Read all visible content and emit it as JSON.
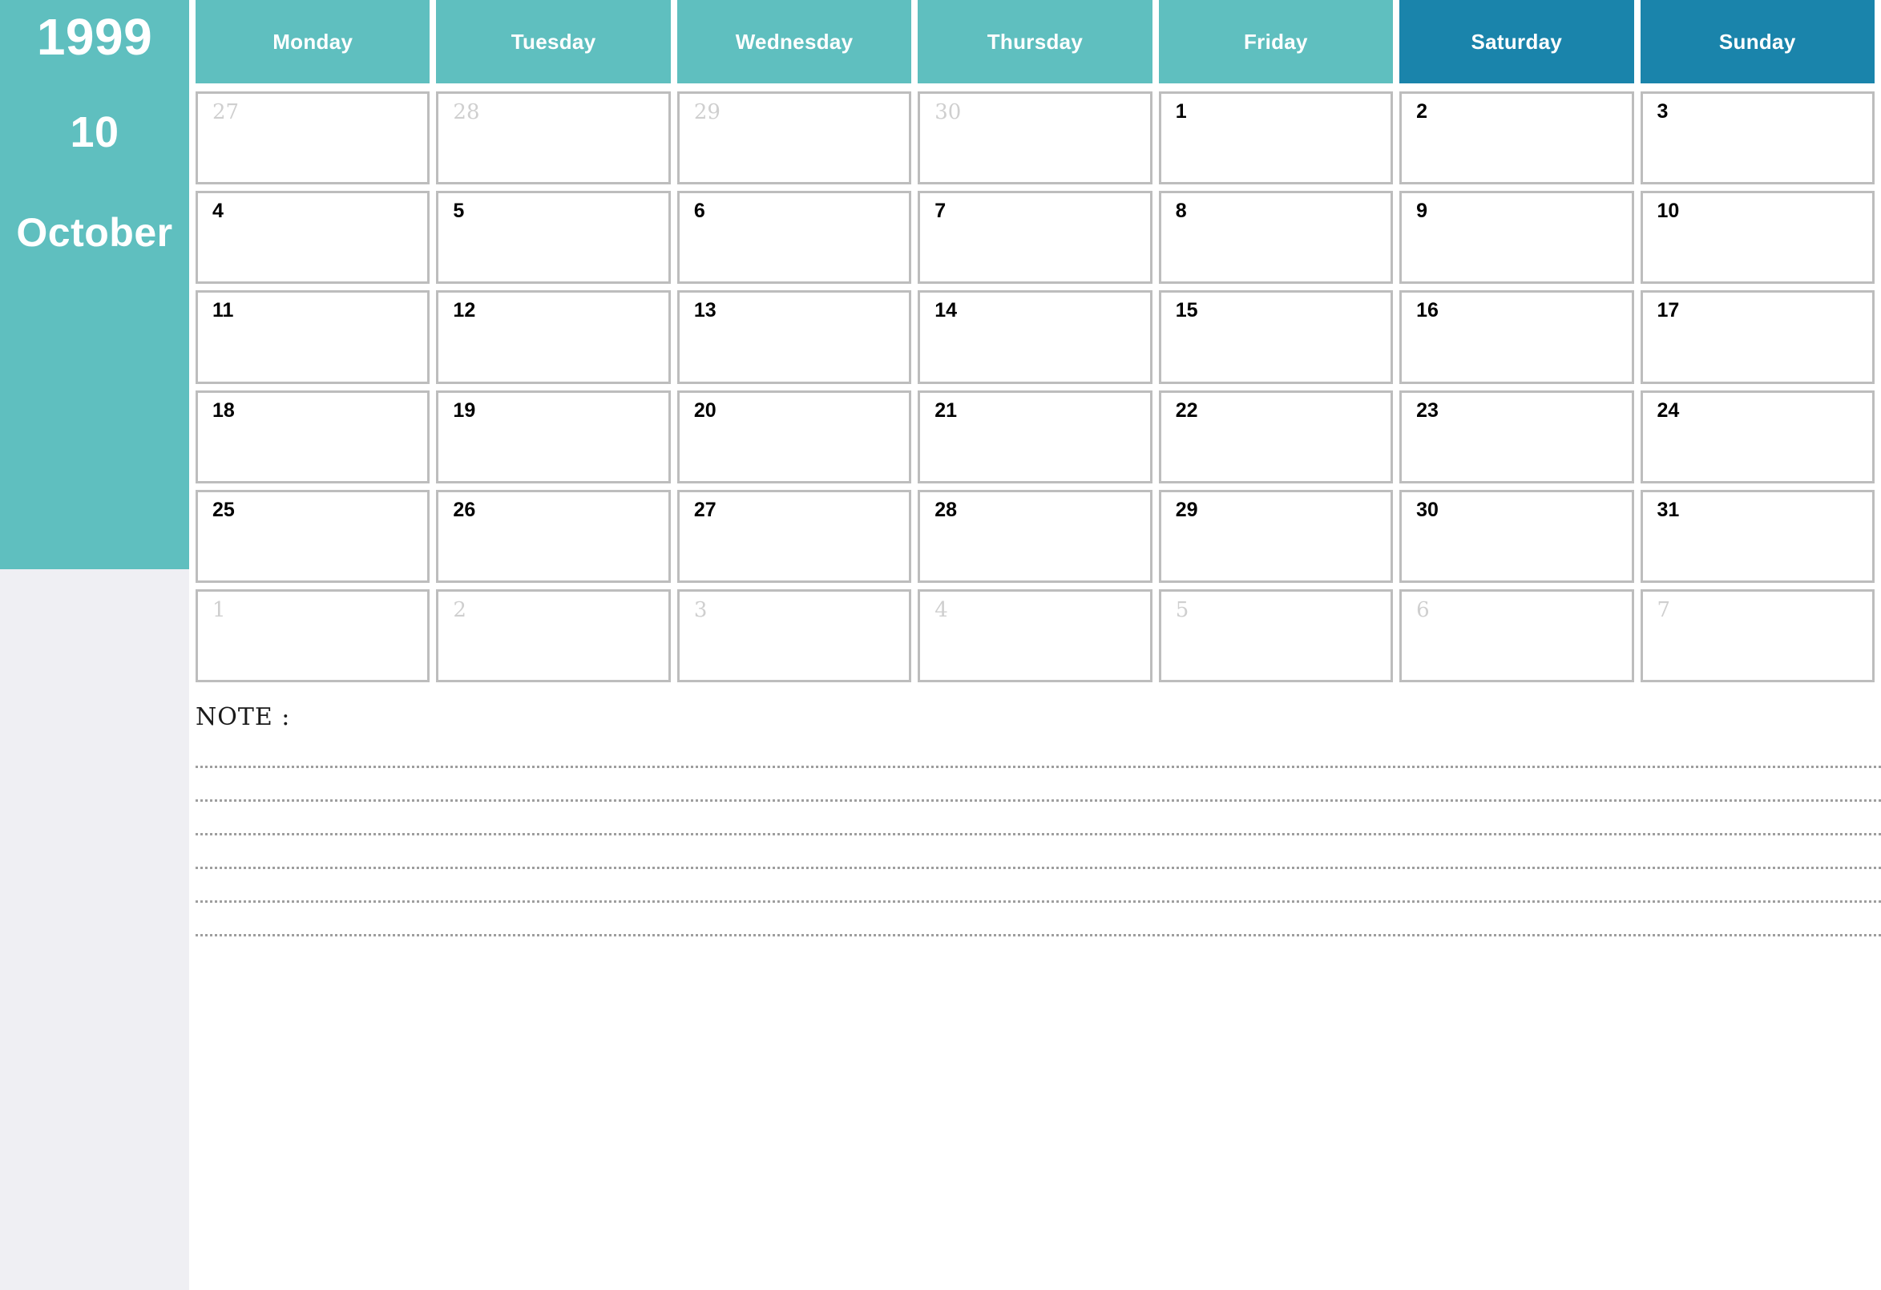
{
  "sidebar": {
    "year": "1999",
    "month_number": "10",
    "month_name": "October",
    "band_color": "#5fbfbf",
    "lower_color": "#efeff3"
  },
  "header": {
    "weekday_color": "#5fbfbf",
    "weekend_color": "#1a84ab",
    "days": [
      {
        "label": "Monday",
        "weekend": false
      },
      {
        "label": "Tuesday",
        "weekend": false
      },
      {
        "label": "Wednesday",
        "weekend": false
      },
      {
        "label": "Thursday",
        "weekend": false
      },
      {
        "label": "Friday",
        "weekend": false
      },
      {
        "label": "Saturday",
        "weekend": true
      },
      {
        "label": "Sunday",
        "weekend": true
      }
    ]
  },
  "calendar": {
    "weeks": [
      [
        {
          "day": "27",
          "in_month": false
        },
        {
          "day": "28",
          "in_month": false
        },
        {
          "day": "29",
          "in_month": false
        },
        {
          "day": "30",
          "in_month": false
        },
        {
          "day": "1",
          "in_month": true
        },
        {
          "day": "2",
          "in_month": true
        },
        {
          "day": "3",
          "in_month": true
        }
      ],
      [
        {
          "day": "4",
          "in_month": true
        },
        {
          "day": "5",
          "in_month": true
        },
        {
          "day": "6",
          "in_month": true
        },
        {
          "day": "7",
          "in_month": true
        },
        {
          "day": "8",
          "in_month": true
        },
        {
          "day": "9",
          "in_month": true
        },
        {
          "day": "10",
          "in_month": true
        }
      ],
      [
        {
          "day": "11",
          "in_month": true
        },
        {
          "day": "12",
          "in_month": true
        },
        {
          "day": "13",
          "in_month": true
        },
        {
          "day": "14",
          "in_month": true
        },
        {
          "day": "15",
          "in_month": true
        },
        {
          "day": "16",
          "in_month": true
        },
        {
          "day": "17",
          "in_month": true
        }
      ],
      [
        {
          "day": "18",
          "in_month": true
        },
        {
          "day": "19",
          "in_month": true
        },
        {
          "day": "20",
          "in_month": true
        },
        {
          "day": "21",
          "in_month": true
        },
        {
          "day": "22",
          "in_month": true
        },
        {
          "day": "23",
          "in_month": true
        },
        {
          "day": "24",
          "in_month": true
        }
      ],
      [
        {
          "day": "25",
          "in_month": true
        },
        {
          "day": "26",
          "in_month": true
        },
        {
          "day": "27",
          "in_month": true
        },
        {
          "day": "28",
          "in_month": true
        },
        {
          "day": "29",
          "in_month": true
        },
        {
          "day": "30",
          "in_month": true
        },
        {
          "day": "31",
          "in_month": true
        }
      ],
      [
        {
          "day": "1",
          "in_month": false
        },
        {
          "day": "2",
          "in_month": false
        },
        {
          "day": "3",
          "in_month": false
        },
        {
          "day": "4",
          "in_month": false
        },
        {
          "day": "5",
          "in_month": false
        },
        {
          "day": "6",
          "in_month": false
        },
        {
          "day": "7",
          "in_month": false
        }
      ]
    ]
  },
  "note": {
    "label": "NOTE :",
    "line_count": 6
  }
}
